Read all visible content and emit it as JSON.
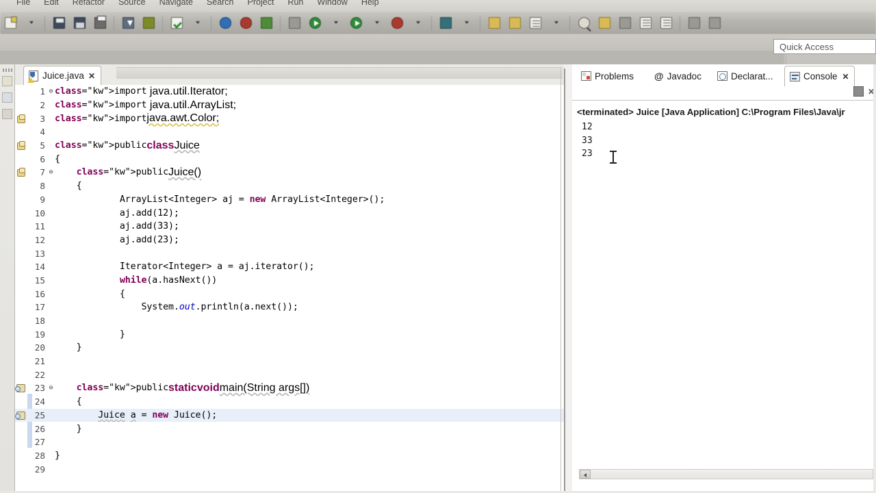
{
  "menu": {
    "items": [
      "File",
      "Edit",
      "Refactor",
      "Source",
      "Navigate",
      "Search",
      "Project",
      "Run",
      "Window",
      "Help"
    ]
  },
  "toolbar": {
    "icons": [
      "new-wizard-icon",
      "dropdown-arrow-icon",
      "save-icon",
      "save-all-icon",
      "print-icon",
      "export-icon",
      "build-icon",
      "validate-icon",
      "search-icon",
      "open-type-icon",
      "open-resource-icon",
      "skip-breakpoints-icon",
      "debug-icon",
      "run-icon",
      "run-dropdown-icon",
      "external-tools-icon",
      "coverage-icon",
      "new-java-project-icon",
      "new-class-icon",
      "new-package-icon",
      "toggle-mark-occurrences-icon",
      "open-task-icon",
      "previous-annotation-icon",
      "next-annotation-icon",
      "last-edit-location-icon",
      "back-icon",
      "forward-icon"
    ]
  },
  "quick_access": {
    "placeholder": "Quick Access",
    "value": "Quick Access"
  },
  "fast_view": {
    "icons": [
      "package-explorer-icon",
      "type-hierarchy-icon",
      "outline-icon"
    ]
  },
  "editor": {
    "tab": {
      "title": "Juice.java",
      "close": "✕",
      "icon": "java-file-warning-icon"
    },
    "current_line": 25,
    "change_bar_lines": [
      23,
      24,
      25,
      26
    ],
    "lines": [
      {
        "n": 1,
        "fold": "⊖",
        "marker": "",
        "text": "import java.util.Iterator;"
      },
      {
        "n": 2,
        "fold": "",
        "marker": "",
        "text": "import java.util.ArrayList;"
      },
      {
        "n": 3,
        "fold": "",
        "marker": "warning",
        "text": "import java.awt.Color;"
      },
      {
        "n": 4,
        "fold": "",
        "marker": "",
        "text": ""
      },
      {
        "n": 5,
        "fold": "",
        "marker": "warning",
        "text": "public class Juice"
      },
      {
        "n": 6,
        "fold": "",
        "marker": "",
        "text": "{"
      },
      {
        "n": 7,
        "fold": "⊖",
        "marker": "warning",
        "text": "    public Juice()"
      },
      {
        "n": 8,
        "fold": "",
        "marker": "",
        "text": "    {"
      },
      {
        "n": 9,
        "fold": "",
        "marker": "",
        "text": "            ArrayList<Integer> aj = new ArrayList<Integer>();"
      },
      {
        "n": 10,
        "fold": "",
        "marker": "",
        "text": "            aj.add(12);"
      },
      {
        "n": 11,
        "fold": "",
        "marker": "",
        "text": "            aj.add(33);"
      },
      {
        "n": 12,
        "fold": "",
        "marker": "",
        "text": "            aj.add(23);"
      },
      {
        "n": 13,
        "fold": "",
        "marker": "",
        "text": ""
      },
      {
        "n": 14,
        "fold": "",
        "marker": "",
        "text": "            Iterator<Integer> a = aj.iterator();"
      },
      {
        "n": 15,
        "fold": "",
        "marker": "",
        "text": "            while(a.hasNext())"
      },
      {
        "n": 16,
        "fold": "",
        "marker": "",
        "text": "            {"
      },
      {
        "n": 17,
        "fold": "",
        "marker": "",
        "text": "                System.out.println(a.next());"
      },
      {
        "n": 18,
        "fold": "",
        "marker": "",
        "text": ""
      },
      {
        "n": 19,
        "fold": "",
        "marker": "",
        "text": "            }"
      },
      {
        "n": 20,
        "fold": "",
        "marker": "",
        "text": "    }"
      },
      {
        "n": 21,
        "fold": "",
        "marker": "",
        "text": ""
      },
      {
        "n": 22,
        "fold": "",
        "marker": "",
        "text": ""
      },
      {
        "n": 23,
        "fold": "⊖",
        "marker": "override",
        "text": "    public static void main(String args[])"
      },
      {
        "n": 24,
        "fold": "",
        "marker": "",
        "text": "    {"
      },
      {
        "n": 25,
        "fold": "",
        "marker": "override",
        "text": "        Juice a = new Juice();"
      },
      {
        "n": 26,
        "fold": "",
        "marker": "",
        "text": "    }"
      },
      {
        "n": 27,
        "fold": "",
        "marker": "",
        "text": ""
      },
      {
        "n": 28,
        "fold": "",
        "marker": "",
        "text": "}"
      },
      {
        "n": 29,
        "fold": "",
        "marker": "",
        "text": ""
      }
    ]
  },
  "console_panel": {
    "tabs": [
      {
        "label": "Problems",
        "icon": "problems-icon",
        "active": false
      },
      {
        "label": "Javadoc",
        "icon": "at-icon",
        "active": false
      },
      {
        "label": "Declarat...",
        "icon": "declaration-icon",
        "active": false
      },
      {
        "label": "Console",
        "icon": "console-icon",
        "active": true,
        "close": "✕"
      }
    ],
    "toolbar": [
      "terminate-button",
      "remove-launch-button"
    ],
    "header": "<terminated> Juice [Java Application] C:\\Program Files\\Java\\jr",
    "output": [
      "12",
      "33",
      "23"
    ],
    "cursor": "text-ibeam-cursor"
  },
  "colors": {
    "keyword": "#7f0055",
    "static_field": "#0000c0",
    "current_line_highlight": "#e8eff9",
    "change_bar": "#c9d8ef",
    "chrome": "#c4c2bc"
  }
}
